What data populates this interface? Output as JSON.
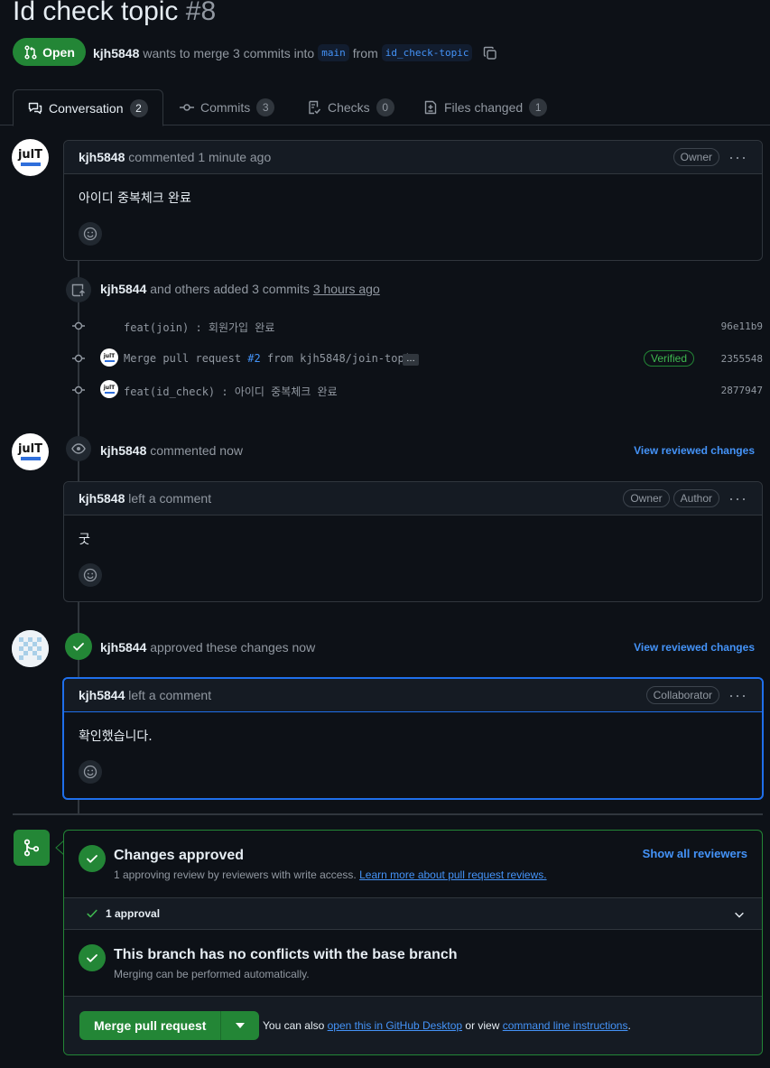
{
  "pr": {
    "title": "Id check topic",
    "number": "#8",
    "state": "Open",
    "author": "kjh5848",
    "summary_mid": "wants to merge 3 commits into",
    "base_branch": "main",
    "from_word": "from",
    "head_branch": "id_check-topic"
  },
  "tabs": [
    {
      "label": "Conversation",
      "count": "2"
    },
    {
      "label": "Commits",
      "count": "3"
    },
    {
      "label": "Checks",
      "count": "0"
    },
    {
      "label": "Files changed",
      "count": "1"
    }
  ],
  "avatar_text": "julT",
  "comment1": {
    "author": "kjh5848",
    "action": "commented",
    "time": "1 minute ago",
    "label": "Owner",
    "body": "아이디 중복체크 완료"
  },
  "commits_event": {
    "actor": "kjh5844",
    "text": "and others added 3 commits",
    "time": "3 hours ago",
    "commits": [
      {
        "message": "feat(join) : 회원가입 완료",
        "sha": "96e11b9"
      },
      {
        "message_pre": "Merge pull request",
        "pr_link": "#2",
        "message_post": "from kjh5848/join-topic",
        "more": "…",
        "verified": "Verified",
        "sha": "2355548"
      },
      {
        "message": "feat(id_check) : 아이디 중복체크 완료",
        "sha": "2877947"
      }
    ]
  },
  "review1": {
    "author": "kjh5848",
    "action": "commented now",
    "view_link": "View reviewed changes",
    "box_author": "kjh5848",
    "box_action": "left a comment",
    "labels": [
      "Owner",
      "Author"
    ],
    "body": "굿"
  },
  "review2": {
    "author": "kjh5844",
    "action": "approved these changes now",
    "view_link": "View reviewed changes",
    "box_author": "kjh5844",
    "box_action": "left a comment",
    "label": "Collaborator",
    "body": "확인했습니다."
  },
  "merge": {
    "approved_title": "Changes approved",
    "approved_sub": "1 approving review by reviewers with write access.",
    "approved_link": "Learn more about pull request reviews.",
    "show_all": "Show all reviewers",
    "approval_count": "1 approval",
    "conflict_title": "This branch has no conflicts with the base branch",
    "conflict_sub": "Merging can be performed automatically.",
    "button": "Merge pull request",
    "also_text": "You can also",
    "desktop_link": "open this in GitHub Desktop",
    "or_view": "or view",
    "cli_link": "command line instructions",
    "period": "."
  },
  "colors": {
    "green": "#238636",
    "blue": "#4493f8",
    "bg": "#0d1117"
  }
}
